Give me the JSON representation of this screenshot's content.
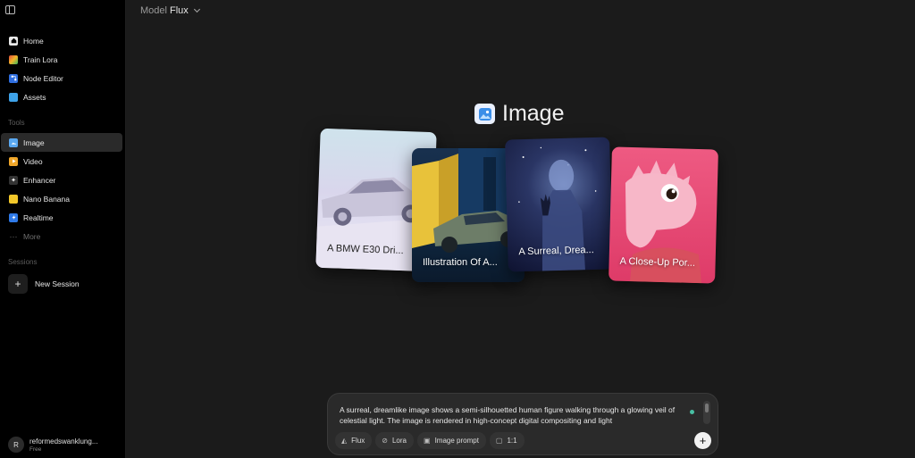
{
  "model_selector": {
    "label": "Model",
    "value": "Flux"
  },
  "sidebar": {
    "main_items": [
      {
        "label": "Home",
        "icon": "home-icon",
        "color": "#e8e8e8"
      },
      {
        "label": "Train Lora",
        "icon": "train-lora-icon",
        "color": "#e04a3a"
      },
      {
        "label": "Node Editor",
        "icon": "node-editor-icon",
        "color": "#2f6fe0"
      },
      {
        "label": "Assets",
        "icon": "folder-icon",
        "color": "#3ea2e8"
      }
    ],
    "tools_label": "Tools",
    "tools": [
      {
        "label": "Image",
        "icon": "image-icon",
        "color": "#5aa8f0",
        "active": true
      },
      {
        "label": "Video",
        "icon": "video-icon",
        "color": "#f0a72a"
      },
      {
        "label": "Enhancer",
        "icon": "enhancer-icon",
        "color": "#3a3a3a"
      },
      {
        "label": "Nano Banana",
        "icon": "banana-icon",
        "color": "#f2c72a"
      },
      {
        "label": "Realtime",
        "icon": "realtime-icon",
        "color": "#2f7ae8"
      }
    ],
    "more_label": "More",
    "sessions_label": "Sessions",
    "new_session_label": "New Session",
    "user": {
      "initial": "R",
      "name": "reformedswanklung...",
      "plan": "Free"
    }
  },
  "hero": {
    "title": "Image",
    "icon": "image-icon"
  },
  "cards": [
    {
      "caption": "A BMW E30 Dri..."
    },
    {
      "caption": "Illustration Of A..."
    },
    {
      "caption": "A Surreal, Drea..."
    },
    {
      "caption": "A Close-Up Por..."
    }
  ],
  "prompt": {
    "text": "A surreal, dreamlike image shows a semi-silhouetted human figure walking through a glowing veil of celestial light. The image is rendered in high-concept digital compositing and light",
    "chips": [
      {
        "label": "Flux",
        "icon": "flux-icon",
        "glyph": "◭"
      },
      {
        "label": "Lora",
        "icon": "lora-icon",
        "glyph": "⊘"
      },
      {
        "label": "Image prompt",
        "icon": "image-prompt-icon",
        "glyph": "▣"
      },
      {
        "label": "1:1",
        "icon": "aspect-ratio-icon",
        "glyph": "▢"
      }
    ],
    "send_glyph": "+"
  }
}
